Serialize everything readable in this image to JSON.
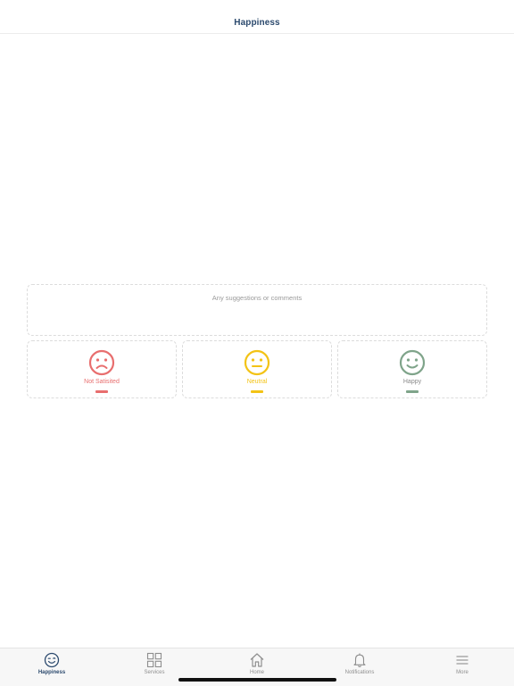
{
  "header": {
    "title": "Happiness"
  },
  "feedback": {
    "comment_placeholder": "Any suggestions or comments"
  },
  "ratings": [
    {
      "label": "Not Satisited",
      "color": "#e86e6e",
      "icon": "sad-face-icon"
    },
    {
      "label": "Neutral",
      "color": "#f3c316",
      "icon": "neutral-face-icon"
    },
    {
      "label": "Happy",
      "color": "#7fa48a",
      "icon": "happy-face-icon"
    }
  ],
  "tabbar": {
    "active_color": "#2c4a6e",
    "items": [
      {
        "label": "Happiness",
        "icon": "happiness-icon",
        "active": true
      },
      {
        "label": "Services",
        "icon": "grid-icon",
        "active": false
      },
      {
        "label": "Home",
        "icon": "home-icon",
        "active": false
      },
      {
        "label": "Notifications",
        "icon": "bell-icon",
        "active": false
      },
      {
        "label": "More",
        "icon": "menu-icon",
        "active": false
      }
    ]
  }
}
